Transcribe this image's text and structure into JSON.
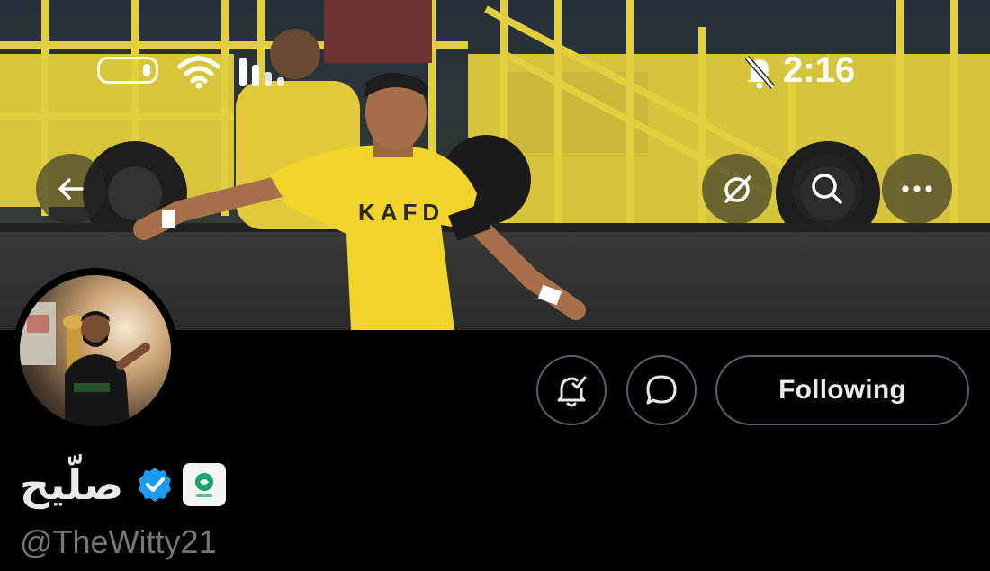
{
  "status_bar": {
    "time": "2:16",
    "icons": [
      "battery-icon",
      "wifi-icon",
      "signal-icon",
      "bell-muted-icon"
    ]
  },
  "header": {
    "back_icon": "arrow-left-icon",
    "grok_icon": "grok-icon",
    "search_icon": "search-icon",
    "more_icon": "more-horizontal-icon"
  },
  "actions": {
    "notifications_icon": "bell-check-icon",
    "message_icon": "message-bubble-icon",
    "follow_label": "Following"
  },
  "profile": {
    "display_name": "صلّيح",
    "handle": "@TheWitty21",
    "verified_icon": "verified-badge-icon",
    "affiliate_icon": "affiliate-badge-icon"
  },
  "banner": {
    "jersey_text": "KAFD"
  },
  "colors": {
    "background": "#000000",
    "verified_blue": "#1d9bf0",
    "button_border": "#536471",
    "handle_gray": "#71767b",
    "text": "#e7e9ea",
    "jersey_yellow": "#f2d32a",
    "affiliate_green": "#1aa36b"
  }
}
